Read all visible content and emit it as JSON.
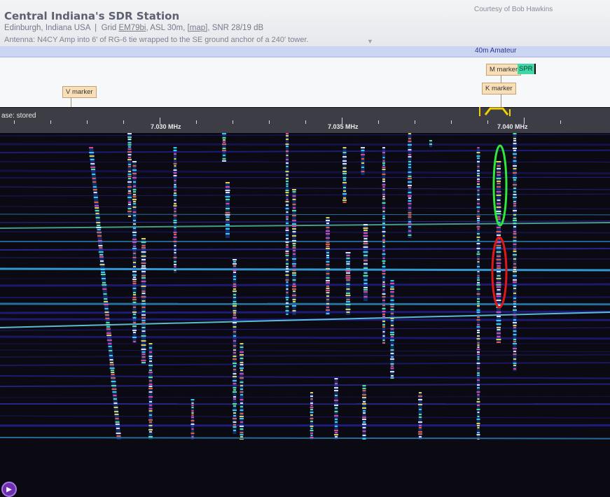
{
  "header": {
    "title": "Central Indiana's SDR Station",
    "location": "Edinburgh, Indiana USA",
    "grid_label": "Grid",
    "grid": "EM79bi",
    "asl": "ASL 30m,",
    "map_link": "[map]",
    "snr": "SNR 28/19 dB",
    "antenna": "Antenna: N4CY Amp into 6' of RG-6 tie wrapped to the SE ground anchor of a 240' tower.",
    "courtesy": "Courtesy of Bob Hawkins",
    "expand_icon": "chevron-down-icon"
  },
  "band": {
    "label": "40m Amateur"
  },
  "markers": {
    "v": "V marker",
    "m": "M marker",
    "k": "K marker",
    "spr": "SPR"
  },
  "scale": {
    "phase": "ase: stored",
    "freq_labels": [
      "7.030 MHz",
      "7.035 MHz",
      "7.040 MHz"
    ]
  },
  "controls": {
    "play_icon": "play-icon"
  },
  "colors": {
    "header_bg": "#eceef2",
    "band_bar": "#cbd5f2",
    "marker_bg": "#f9dfb8",
    "spr": "#3fd7a6",
    "waterfall_bg": "#0b0a12",
    "passband": "#f2d000",
    "annotation_green": "#2fe83a",
    "annotation_red": "#e01818"
  }
}
